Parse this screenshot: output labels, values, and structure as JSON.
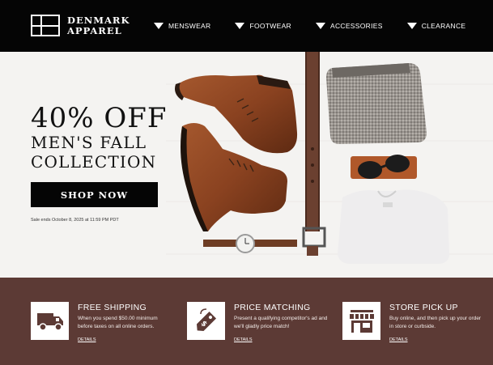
{
  "brand": {
    "line1": "DENMARK",
    "line2": "APPAREL"
  },
  "nav": {
    "items": [
      {
        "label": "MENSWEAR"
      },
      {
        "label": "FOOTWEAR"
      },
      {
        "label": "ACCESSORIES"
      },
      {
        "label": "CLEARANCE"
      }
    ]
  },
  "hero": {
    "headline": "40% OFF",
    "subhead_line1": "MEN'S FALL",
    "subhead_line2": "COLLECTION",
    "cta_label": "SHOP NOW",
    "sale_note": "Sale ends October 8, 2025 at 11:59 PM PDT"
  },
  "features": [
    {
      "icon": "truck-icon",
      "title": "FREE SHIPPING",
      "desc": "When you spend $50.00 minimum before taxes on all online orders.",
      "link": "DETAILS"
    },
    {
      "icon": "price-tag-icon",
      "title": "PRICE MATCHING",
      "desc": "Present a qualifying competitor's ad and we'll gladly price match!",
      "link": "DETAILS"
    },
    {
      "icon": "storefront-icon",
      "title": "STORE PICK UP",
      "desc": "Buy online, and then pick up your order in store or curbside.",
      "link": "DETAILS"
    }
  ],
  "colors": {
    "header_bg": "#050505",
    "hero_bg": "#f4f3f1",
    "features_bg": "#5c3a35",
    "button_bg": "#050505"
  }
}
